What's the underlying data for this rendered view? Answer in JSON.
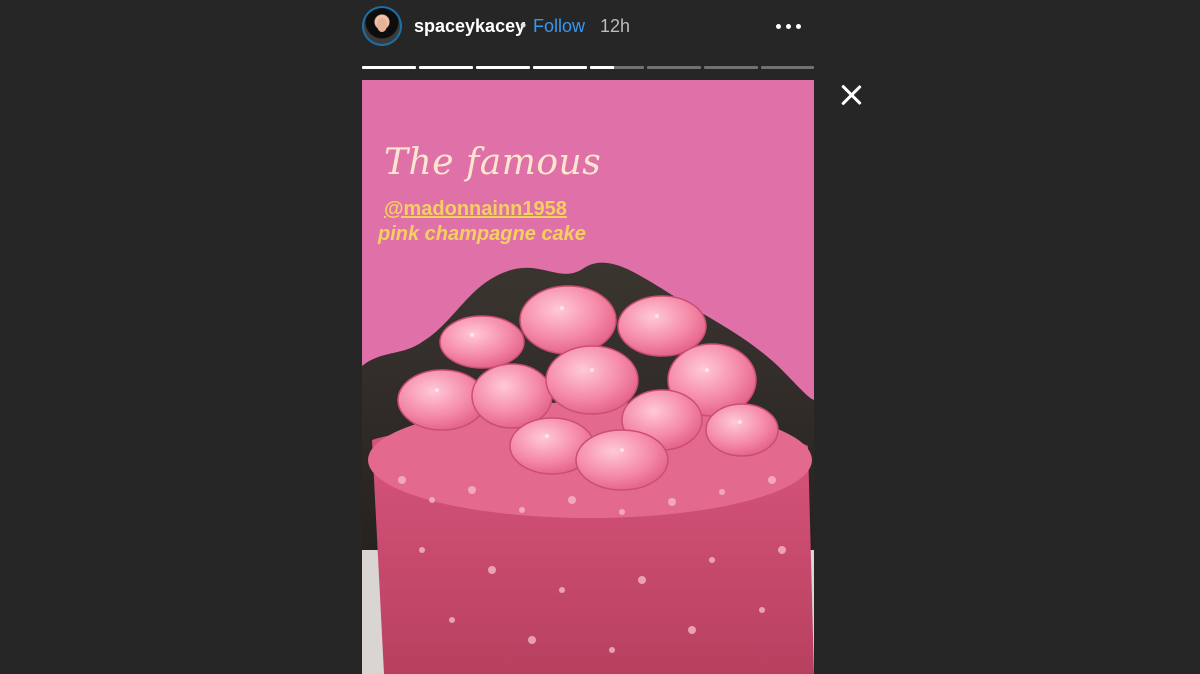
{
  "header": {
    "username": "spaceykacey",
    "separator": "•",
    "follow_label": "Follow",
    "time": "12h"
  },
  "progress": {
    "segments": 8,
    "current_index": 4,
    "current_fraction": 0.45
  },
  "story": {
    "title_script": "The famous",
    "mention": "@madonnainn1958",
    "subtitle": "pink champagne cake"
  },
  "colors": {
    "background": "#262626",
    "story_bg": "#e070a8",
    "follow": "#3897f0",
    "caption_yellow": "#f4cf61"
  }
}
